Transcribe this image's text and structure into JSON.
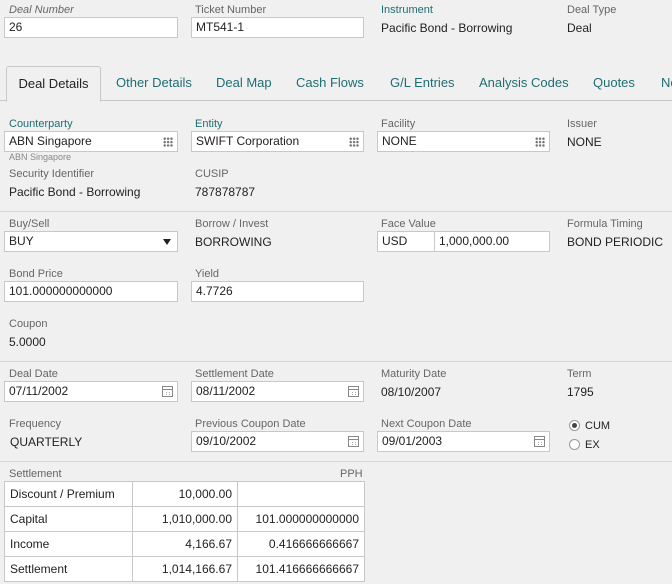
{
  "header": {
    "deal_number": {
      "label": "Deal Number",
      "value": "26"
    },
    "ticket_number": {
      "label": "Ticket Number",
      "value": "MT541-1"
    },
    "instrument": {
      "label": "Instrument",
      "value": "Pacific Bond - Borrowing"
    },
    "deal_type": {
      "label": "Deal Type",
      "value": "Deal"
    }
  },
  "tabs": [
    {
      "label": "Deal Details",
      "active": true
    },
    {
      "label": "Other Details"
    },
    {
      "label": "Deal Map"
    },
    {
      "label": "Cash Flows"
    },
    {
      "label": "G/L Entries"
    },
    {
      "label": "Analysis Codes"
    },
    {
      "label": "Quotes"
    },
    {
      "label": "No"
    }
  ],
  "details": {
    "counterparty": {
      "label": "Counterparty",
      "value": "ABN Singapore",
      "hint": "ABN Singapore"
    },
    "entity": {
      "label": "Entity",
      "value": "SWIFT Corporation"
    },
    "facility": {
      "label": "Facility",
      "value": "NONE"
    },
    "issuer": {
      "label": "Issuer",
      "value": "NONE"
    },
    "security_identifier": {
      "label": "Security Identifier",
      "value": "Pacific Bond - Borrowing"
    },
    "cusip": {
      "label": "CUSIP",
      "value": "787878787"
    },
    "buy_sell": {
      "label": "Buy/Sell",
      "value": "BUY"
    },
    "borrow_invest": {
      "label": "Borrow / Invest",
      "value": "BORROWING"
    },
    "face_value": {
      "label": "Face Value",
      "currency": "USD",
      "amount": "1,000,000.00"
    },
    "formula_timing": {
      "label": "Formula Timing",
      "value": "BOND PERIODIC"
    },
    "bond_price": {
      "label": "Bond Price",
      "value": "101.000000000000"
    },
    "yield": {
      "label": "Yield",
      "value": "4.7726"
    },
    "coupon": {
      "label": "Coupon",
      "value": "5.0000"
    },
    "deal_date": {
      "label": "Deal Date",
      "value": "07/11/2002"
    },
    "settlement_date": {
      "label": "Settlement Date",
      "value": "08/11/2002"
    },
    "maturity_date": {
      "label": "Maturity Date",
      "value": "08/10/2007"
    },
    "term": {
      "label": "Term",
      "value": "1795"
    },
    "frequency": {
      "label": "Frequency",
      "value": "QUARTERLY"
    },
    "previous_coupon_date": {
      "label": "Previous Coupon Date",
      "value": "09/10/2002"
    },
    "next_coupon_date": {
      "label": "Next Coupon Date",
      "value": "09/01/2003"
    },
    "cum_ex": {
      "options": [
        "CUM",
        "EX"
      ],
      "selected": "CUM"
    }
  },
  "settlement": {
    "label": "Settlement",
    "pph_label": "PPH",
    "rows": [
      [
        "Discount / Premium",
        "10,000.00",
        ""
      ],
      [
        "Capital",
        "1,010,000.00",
        "101.000000000000"
      ],
      [
        "Income",
        "4,166.67",
        "0.416666666667"
      ],
      [
        "Settlement",
        "1,014,166.67",
        "101.416666666667"
      ]
    ]
  }
}
